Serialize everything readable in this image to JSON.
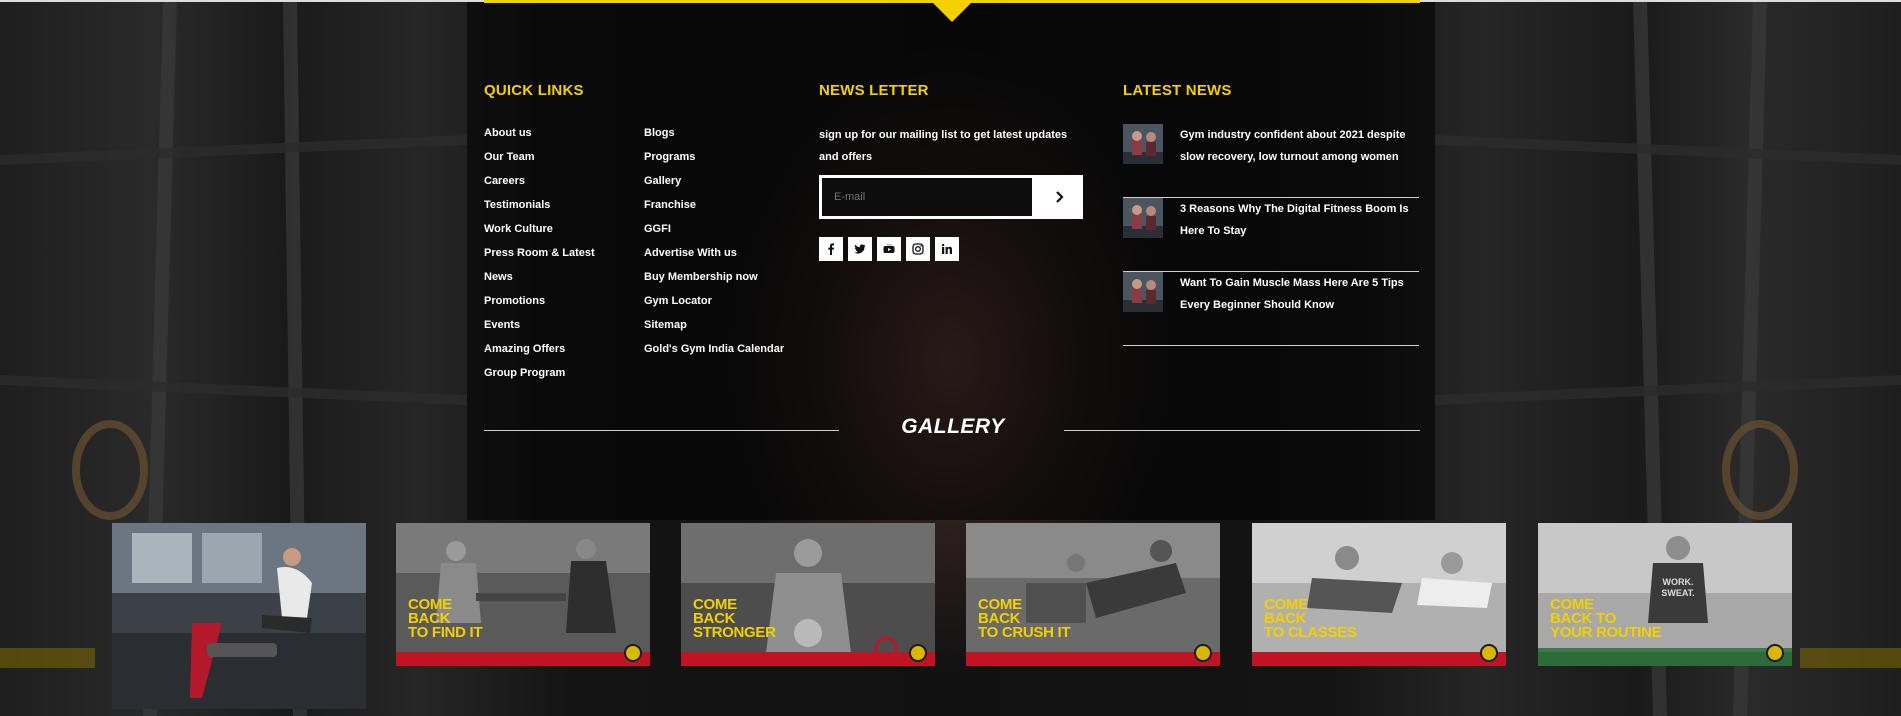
{
  "quick_links": {
    "title": "QUICK LINKS",
    "col1": [
      "About us",
      "Our Team",
      "Careers",
      "Testimonials",
      "Work Culture",
      "Press Room & Latest",
      "News",
      "Promotions",
      "Events",
      "Amazing Offers",
      "Group Program"
    ],
    "col2": [
      "Blogs",
      "Programs",
      "Gallery",
      "Franchise",
      "GGFI",
      "Advertise With us",
      "Buy Membership now",
      "Gym Locator",
      "Sitemap",
      "Gold's Gym India Calendar"
    ]
  },
  "newsletter": {
    "title": "NEWS LETTER",
    "text": "sign up for our mailing list to get latest updates and offers",
    "placeholder": "E-mail",
    "submit_icon": "chevron-right-icon",
    "social": [
      "facebook-icon",
      "twitter-icon",
      "youtube-icon",
      "instagram-icon",
      "linkedin-icon"
    ]
  },
  "latest_news": {
    "title": "LATEST NEWS",
    "items": [
      "Gym industry confident about 2021 despite slow recovery, low turnout among women",
      "3 Reasons Why The Digital Fitness Boom Is Here To Stay",
      "Want To Gain Muscle Mass Here Are 5 Tips Every Beginner Should Know"
    ]
  },
  "gallery": {
    "title": "GALLERY",
    "tiles": [
      {
        "caption": ""
      },
      {
        "caption": "COME\nBACK\nTO FIND IT"
      },
      {
        "caption": "COME\nBACK\nSTRONGER"
      },
      {
        "caption": "COME\nBACK\nTO CRUSH IT"
      },
      {
        "caption": "COME\nBACK\nTO CLASSES"
      },
      {
        "caption": "COME\nBACK TO\nYOUR ROUTINE"
      }
    ]
  },
  "colors": {
    "accent": "#f3d000",
    "brand_red": "#c01425"
  }
}
